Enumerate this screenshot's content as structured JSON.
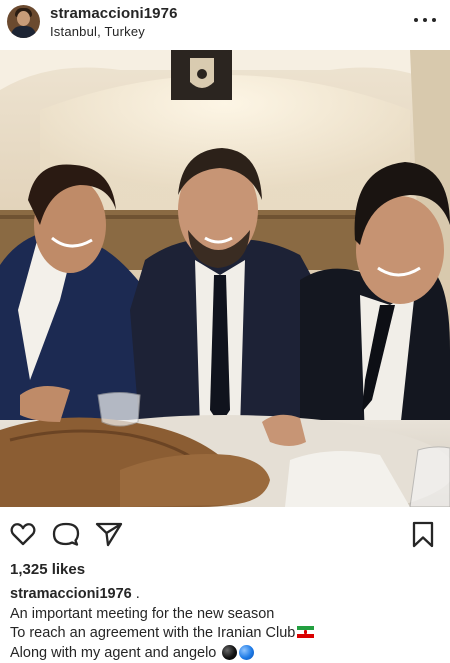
{
  "post": {
    "username": "stramaccioni1976",
    "location": "Istanbul, Turkey"
  },
  "photo": {
    "description_icon": "photo-image"
  },
  "actions": {
    "like_icon": "heart-icon",
    "comment_icon": "comment-icon",
    "share_icon": "send-icon",
    "save_icon": "bookmark-icon"
  },
  "likes": {
    "count_text": "1,325 likes"
  },
  "caption": {
    "owner": "stramaccioni1976",
    "owner_suffix": " .",
    "line1": "An important meeting for the new season",
    "line2": "To reach an agreement with the Iranian Club",
    "line3": "Along with my agent and angelo"
  },
  "colors": {
    "text": "#262626",
    "background": "#ffffff"
  }
}
